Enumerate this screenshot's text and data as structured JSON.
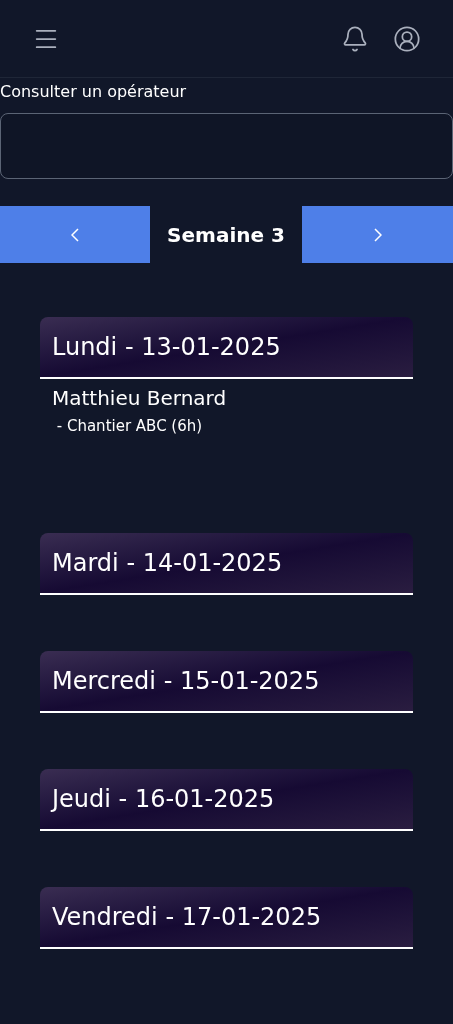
{
  "search": {
    "label": "Consulter un opérateur"
  },
  "week": {
    "title": "Semaine 3"
  },
  "days": [
    {
      "title": "Lundi - 13-01-2025",
      "entries": [
        {
          "name": "Matthieu Bernard",
          "tasks": [
            " - Chantier ABC (6h)"
          ]
        }
      ]
    },
    {
      "title": "Mardi - 14-01-2025"
    },
    {
      "title": "Mercredi - 15-01-2025"
    },
    {
      "title": "Jeudi - 16-01-2025"
    },
    {
      "title": "Vendredi - 17-01-2025"
    }
  ]
}
